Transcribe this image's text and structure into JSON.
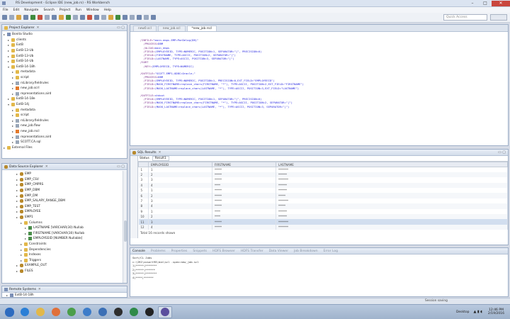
{
  "window": {
    "title": "RS Development - Eclipse IDE (new_job.rs) - RS Workbench",
    "ghost_tabs": [
      "",
      "",
      "",
      "",
      ""
    ],
    "controls": {
      "minimize": "–",
      "maximize": "□",
      "close": "✕"
    }
  },
  "menubar": [
    "File",
    "Edit",
    "Navigate",
    "Search",
    "Project",
    "Run",
    "Window",
    "Help"
  ],
  "quick_access": {
    "placeholder": "Quick Access"
  },
  "project_explorer": {
    "title": "Project Explorer",
    "items": [
      {
        "label": "Bonita Studio",
        "indent": 0,
        "expanded": false,
        "icon": "project-icon"
      },
      {
        "label": "clients",
        "indent": 1,
        "expanded": false,
        "icon": "folder-icon"
      },
      {
        "label": "ExtB",
        "indent": 1,
        "expanded": false,
        "icon": "folder-icon"
      },
      {
        "label": "ExtB-13-Ub",
        "indent": 1,
        "expanded": false,
        "icon": "folder-icon"
      },
      {
        "label": "ExtB-13-Ub",
        "indent": 1,
        "expanded": false,
        "icon": "folder-icon"
      },
      {
        "label": "ExtB-14-Ub",
        "indent": 1,
        "expanded": false,
        "icon": "folder-icon"
      },
      {
        "label": "ExtB-14-18h",
        "indent": 1,
        "expanded": true,
        "icon": "folder-icon"
      },
      {
        "label": "metadata",
        "indent": 2,
        "expanded": false,
        "icon": "folder-icon"
      },
      {
        "label": "script",
        "indent": 2,
        "expanded": false,
        "icon": "folder-icon"
      },
      {
        "label": "rsLibrary.fieldrules",
        "indent": 2,
        "expanded": false,
        "icon": "file-icon"
      },
      {
        "label": "new_job.scrl",
        "indent": 2,
        "expanded": false,
        "icon": "xml-file-icon"
      },
      {
        "label": "representations.aird",
        "indent": 2,
        "expanded": false,
        "icon": "file-icon"
      },
      {
        "label": "ExtB-14-18e",
        "indent": 1,
        "expanded": false,
        "icon": "folder-icon"
      },
      {
        "label": "ExtB-14j",
        "indent": 1,
        "expanded": true,
        "icon": "folder-icon"
      },
      {
        "label": "metadata",
        "indent": 2,
        "expanded": false,
        "icon": "folder-icon"
      },
      {
        "label": "script",
        "indent": 2,
        "expanded": false,
        "icon": "folder-icon"
      },
      {
        "label": "rsLibrary.fieldrules",
        "indent": 2,
        "expanded": false,
        "icon": "file-icon"
      },
      {
        "label": "new_job.flow",
        "indent": 2,
        "expanded": false,
        "icon": "file-icon"
      },
      {
        "label": "new_job.rscl",
        "indent": 2,
        "expanded": false,
        "icon": "xml-file-icon"
      },
      {
        "label": "representations.aird",
        "indent": 2,
        "expanded": false,
        "icon": "file-icon"
      },
      {
        "label": "SCOTT.CA.sql",
        "indent": 2,
        "expanded": false,
        "icon": "file-icon"
      },
      {
        "label": "External Files",
        "indent": 0,
        "expanded": false,
        "icon": "folder-icon"
      }
    ]
  },
  "datasource_explorer": {
    "title": "Data Source Explorer",
    "items": [
      {
        "label": "EMP",
        "indent": 3,
        "icon": "db-icon"
      },
      {
        "label": "EMP_CSV",
        "indent": 3,
        "icon": "db-icon"
      },
      {
        "label": "EMP_CMPRS",
        "indent": 3,
        "icon": "db-icon"
      },
      {
        "label": "EMP_DBM",
        "indent": 3,
        "icon": "db-icon"
      },
      {
        "label": "EMP_DM",
        "indent": 3,
        "icon": "db-icon"
      },
      {
        "label": "EMP_SALARY_RANGE_DBM",
        "indent": 3,
        "icon": "db-icon"
      },
      {
        "label": "EMP_TEST",
        "indent": 3,
        "icon": "db-icon"
      },
      {
        "label": "EMPLOYEE",
        "indent": 3,
        "icon": "db-icon"
      },
      {
        "label": "EMP1",
        "indent": 3,
        "icon": "db-icon"
      },
      {
        "label": "Columns",
        "indent": 4,
        "icon": "folder-icon"
      },
      {
        "label": "LASTNAME [VARCHAR(30) Nullab",
        "indent": 5,
        "icon": "column-icon"
      },
      {
        "label": "FIRSTNAME [VARCHAR(30) Nullab",
        "indent": 5,
        "icon": "column-icon"
      },
      {
        "label": "EMPLOYEEID [NUMBER Nullable]",
        "indent": 5,
        "icon": "column-icon"
      },
      {
        "label": "Constraints",
        "indent": 4,
        "icon": "folder-icon"
      },
      {
        "label": "Dependencies",
        "indent": 4,
        "icon": "folder-icon"
      },
      {
        "label": "Indexes",
        "indent": 4,
        "icon": "folder-icon"
      },
      {
        "label": "Triggers",
        "indent": 4,
        "icon": "folder-icon"
      },
      {
        "label": "EXAMPLE_OUT",
        "indent": 3,
        "icon": "db-icon"
      },
      {
        "label": "FILES",
        "indent": 3,
        "icon": "db-icon"
      }
    ]
  },
  "remote_systems": {
    "title": "Remote Systems",
    "items": [
      "ExtB-14-18h"
    ]
  },
  "editor": {
    "tabs": [
      {
        "label": "new0.scl",
        "active": false
      },
      {
        "label": "new_job.scl",
        "active": false
      },
      {
        "label": "*new_job.rscl",
        "active": true
      }
    ],
    "code": [
      {
        "kw": "",
        "rest": ""
      },
      {
        "kw": "/INFILE=",
        "rest": "\"main.emps.EMP=ParDelog(DB)\""
      },
      {
        "kw": "  /PROCESS=",
        "rest": "DBM"
      },
      {
        "kw": "  /ALIAS=",
        "rest": "main_emps"
      },
      {
        "kw": "  /FIELD=",
        "rest": "(EMPLOYEEID, TYPE=NUMERIC, POSITION=1, SEPARATOR=\"|\", PRECISION=0)"
      },
      {
        "kw": "  /FIELD=",
        "rest": "(FIRSTNAME, TYPE=ASCII, POSITION=2, SEPARATOR=\"|\")"
      },
      {
        "kw": "  /FIELD=",
        "rest": "(LASTNAME, TYPE=ASCII, POSITION=3, SEPARATOR=\"|\")"
      },
      {
        "kw": "/SORT",
        "rest": ""
      },
      {
        "kw": "  /KEY=",
        "rest": "(EMPLOYEEID, TYPE=NUMERIC)"
      },
      {
        "kw": "",
        "rest": ""
      },
      {
        "kw": "/OUTFILE=",
        "rest": "\"SCOTT.EMP1;ODBC=Oracle;\""
      },
      {
        "kw": "  /PROCESS=",
        "rest": "DBM"
      },
      {
        "kw": "  /FIELD=",
        "rest": "(EMPLOYEEID, TYPE=NUMERIC, POSITION=1, PRECISION=0,EXT_FIELD=\"EMPLOYEEID\")"
      },
      {
        "kw": "  /FIELD=",
        "rest": "(MASK_FIRSTNAME=replace_chars(FIRSTNAME, \"*\"), TYPE=ASCII, POSITION=2,EXT_FIELD=\"FIRSTNAME\")"
      },
      {
        "kw": "  /FIELD=",
        "rest": "(MASK_LASTNAME=replace_chars(LASTNAME, \"*\"), TYPE=ASCII, POSITION=3,EXT_FIELD=\"LASTNAME\")"
      },
      {
        "kw": "",
        "rest": ""
      },
      {
        "kw": "/OUTFILE=",
        "rest": "stdout"
      },
      {
        "kw": "  /FIELD=",
        "rest": "(EMPLOYEEID, TYPE=NUMERIC, POSITION=1, SEPARATOR=\"|\", PRECISION=0)"
      },
      {
        "kw": "  /FIELD=",
        "rest": "(MASK_FIRSTNAME=replace_chars(FIRSTNAME, \"*\"), TYPE=ASCII, POSITION=2, SEPARATOR=\"|\")"
      },
      {
        "kw": "  /FIELD=",
        "rest": "(MASK_LASTNAME=replace_chars(LASTNAME, \"*\"), TYPE=ASCII, POSITION=3, SEPARATOR=\"|\")"
      }
    ]
  },
  "sql_results": {
    "title": "SQL Results",
    "subtabs": [
      "Status",
      "Result1"
    ],
    "columns": [
      "",
      "EMPLOYEEID",
      "FIRSTNAME",
      "LASTNAME"
    ],
    "rows": [
      [
        "1",
        "1",
        "*****",
        "*******"
      ],
      [
        "2",
        "2",
        "*****",
        "******"
      ],
      [
        "3",
        "3",
        "*****",
        "*******"
      ],
      [
        "4",
        "4",
        "****",
        "******"
      ],
      [
        "5",
        "1",
        "*****",
        "******"
      ],
      [
        "6",
        "2",
        "*****",
        "*****"
      ],
      [
        "7",
        "3",
        "*****",
        "*******"
      ],
      [
        "8",
        "4",
        "*****",
        "*****"
      ],
      [
        "9",
        "1",
        "****",
        "******"
      ],
      [
        "10",
        "2",
        "****",
        "******"
      ],
      [
        "11",
        "3",
        "*****",
        "*******"
      ],
      [
        "12",
        "4",
        "*****",
        "*******"
      ]
    ],
    "footer": "Total 16 records shown"
  },
  "console": {
    "tabs": [
      "Console",
      "Problems",
      "Properties",
      "Snippets",
      "HDFS Browser",
      "HDFS Transfer",
      "Data Viewer",
      "Job Breakdown",
      "Error Log"
    ],
    "header": "Sort/CL Jobs",
    "lines": [
      "c:\\IRI\\cosort95\\bin\\scl -spec=new_job.scl",
      "1|*****|*******",
      "2|*****|******",
      "3|*****|*******",
      "4|****|******"
    ]
  },
  "statusbar": {
    "right_text": "Session saving"
  },
  "taskbar": {
    "apps": [
      "start-orb",
      "ie-icon",
      "explorer-icon",
      "media-icon",
      "chrome-icon",
      "lync-icon",
      "outlook-icon",
      "iri-icon",
      "excel-icon",
      "cmd-icon",
      "eclipse-icon"
    ],
    "desktop_label": "Desktop",
    "time": "12:46 PM",
    "date": "2/19/2016"
  }
}
